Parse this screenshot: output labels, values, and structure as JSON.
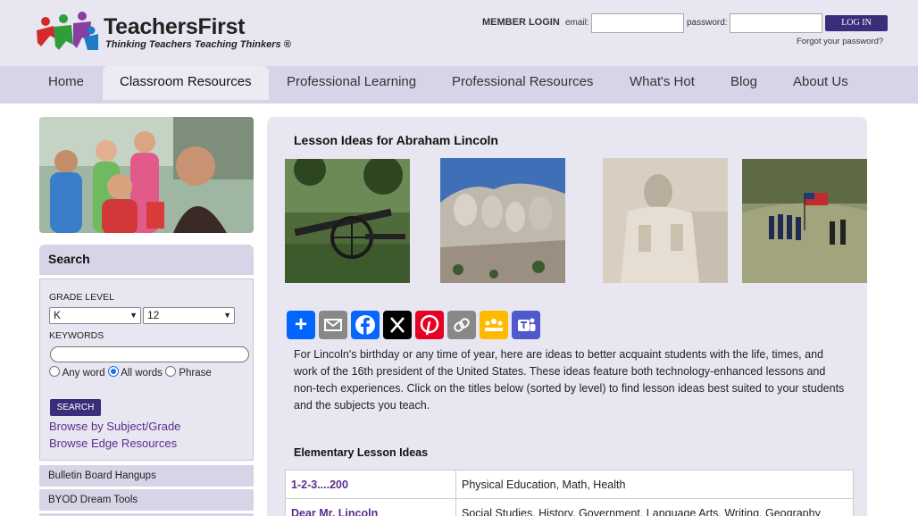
{
  "header": {
    "logo_name": "TeachersFirst",
    "logo_tagline": "Thinking Teachers Teaching Thinkers ®",
    "login": {
      "title": "MEMBER LOGIN",
      "email_label": "email:",
      "password_label": "password:",
      "button": "LOG IN",
      "forgot": "Forgot your password?"
    }
  },
  "nav": {
    "items": [
      "Home",
      "Classroom Resources",
      "Professional Learning",
      "Professional Resources",
      "What's Hot",
      "Blog",
      "About Us"
    ],
    "active": "Classroom Resources"
  },
  "sidebar": {
    "search_title": "Search",
    "grade_level_label": "GRADE LEVEL",
    "grade_from": "K",
    "grade_to": "12",
    "keywords_label": "KEYWORDS",
    "radios": [
      "Any word",
      "All words",
      "Phrase"
    ],
    "radio_selected": "All words",
    "search_button": "SEARCH",
    "links": [
      "Browse by Subject/Grade",
      "Browse Edge Resources"
    ],
    "menu": [
      "Bulletin Board Hangups",
      "BYOD Dream Tools"
    ]
  },
  "main": {
    "title": "Lesson Ideas for Abraham Lincoln",
    "share_icons": [
      "share-plus-icon",
      "email-icon",
      "facebook-icon",
      "x-icon",
      "pinterest-icon",
      "copy-link-icon",
      "google-classroom-icon",
      "teams-icon"
    ],
    "share_colors": {
      "plus": "#0166ff",
      "email": "#888888",
      "facebook": "#0866ff",
      "x": "#000000",
      "pinterest": "#e60023",
      "link": "#888888",
      "classroom": "#ffba00",
      "teams": "#5059c9"
    },
    "intro": "For Lincoln's birthday or any time of year, here are ideas to better acquaint students with the life, times, and work of the 16th president of the United States. These ideas feature both technology-enhanced lessons and non-tech experiences. Click on the titles below (sorted by level) to find lesson ideas best suited to your students and the subjects you teach.",
    "section_title": "Elementary Lesson Ideas",
    "lessons": [
      {
        "title": "1-2-3....200",
        "subjects": "Physical Education, Math, Health"
      },
      {
        "title": "Dear Mr. Lincoln",
        "subjects": "Social Studies, History, Government, Language Arts, Writing, Geography"
      }
    ]
  }
}
